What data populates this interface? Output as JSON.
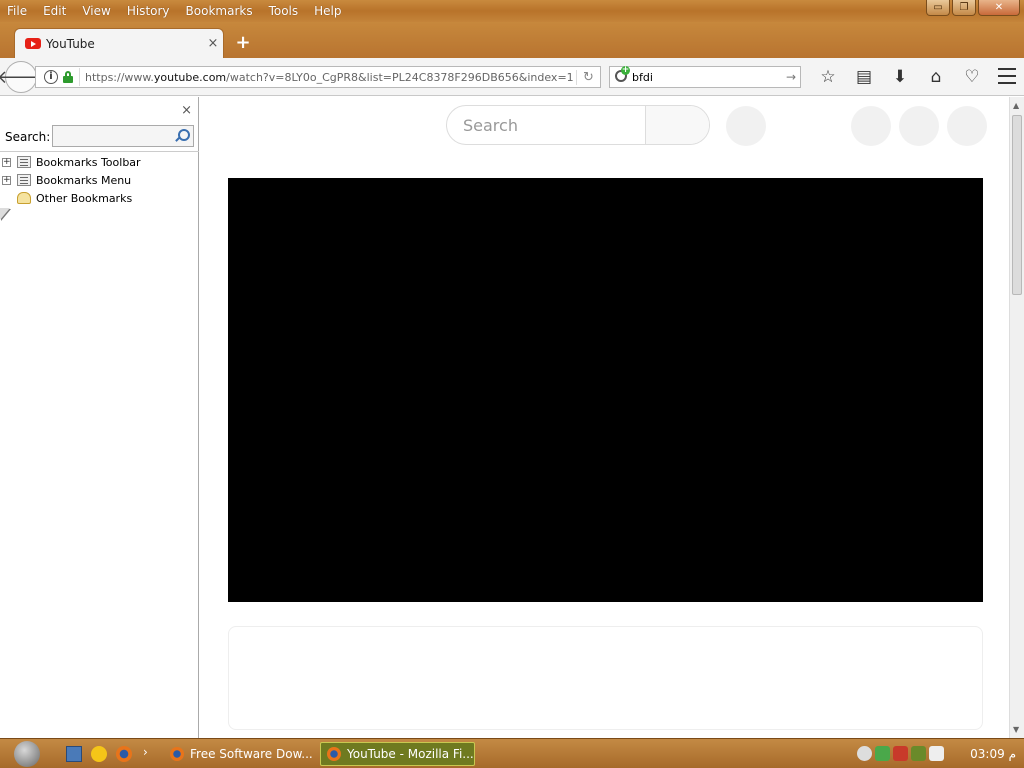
{
  "menubar": {
    "items": [
      "File",
      "Edit",
      "View",
      "History",
      "Bookmarks",
      "Tools",
      "Help"
    ]
  },
  "window_controls": {
    "minimize": "▭",
    "restore": "❐",
    "close": "✕"
  },
  "tab": {
    "title": "YouTube",
    "close": "×",
    "new_tab": "+"
  },
  "navbar": {
    "url_prefix": "https://www.",
    "url_domain": "youtube.com",
    "url_rest": "/watch?v=8LY0o_CgPR8&list=PL24C8378F296DB656&index=1",
    "search_value": "bfdi"
  },
  "sidebar": {
    "search_label": "Search:",
    "close": "×",
    "items": [
      {
        "label": "Bookmarks Toolbar",
        "expandable": true
      },
      {
        "label": "Bookmarks Menu",
        "expandable": true
      },
      {
        "label": "Other Bookmarks",
        "expandable": false
      }
    ]
  },
  "content": {
    "search_placeholder": "Search"
  },
  "taskbar": {
    "tasks": [
      "Free Software Dow...",
      "YouTube - Mozilla Fi..."
    ],
    "clock": "03:09 م"
  },
  "colors": {
    "youtube_red": "#e62117",
    "wood_accent": "#b8732a",
    "active_task": "#6f7a20"
  }
}
